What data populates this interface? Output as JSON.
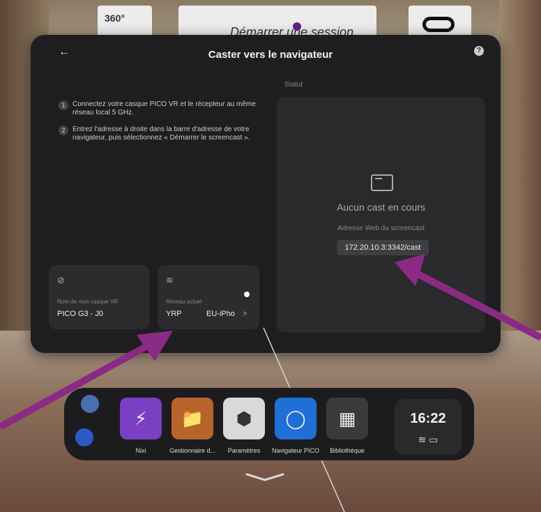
{
  "background": {
    "panel_a_text": "360°",
    "panel_b_text": "Démarrer une session"
  },
  "panel": {
    "title": "Caster vers le navigateur",
    "back_icon": "←",
    "help_icon": "?",
    "steps": [
      {
        "num": "1",
        "text": "Connectez votre casque PICO VR et le récepteur au même réseau local 5 GHz."
      },
      {
        "num": "2",
        "text": "Entrez l'adresse à droite dans la barre d'adresse de votre navigateur, puis sélectionnez « Démarrer le screencast »."
      }
    ],
    "status_label": "Statut",
    "no_cast": "Aucun cast en cours",
    "address_label": "Adresse Web du screencast",
    "address": "172.20.10.3:3342/cast",
    "device_card": {
      "label": "Nom de mon casque VR",
      "value": "PICO G3 - J0"
    },
    "network_card": {
      "label": "Réseau actuel",
      "value_left": "YRP",
      "value_right": "EU-iPho",
      "chevron": ">"
    }
  },
  "dock": {
    "apps": [
      {
        "label": "Nixi",
        "color": "#7b3fc4"
      },
      {
        "label": "Gestionnaire d...",
        "color": "#b8642a"
      },
      {
        "label": "Paramètres",
        "color": "#d9d9d9"
      },
      {
        "label": "Navigateur PICO",
        "color": "#1f6fd6"
      },
      {
        "label": "Bibliothèque",
        "color": "#3a3a3c"
      }
    ],
    "time": "16:22"
  }
}
